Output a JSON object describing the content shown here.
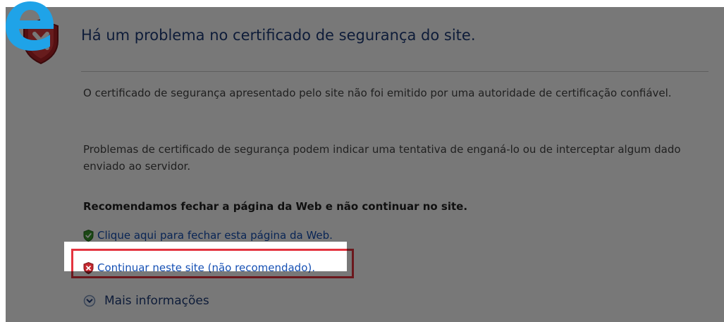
{
  "page": {
    "title": "Há um problema no certificado de segurança do site.",
    "paragraph1": "O certificado de segurança apresentado pelo site não foi emitido por uma autoridade de certificação confiável.",
    "paragraph2": "Problemas de certificado de segurança podem indicar uma tentativa de enganá-lo ou de interceptar algum dado enviado ao servidor.",
    "recommendation": "Recomendamos fechar a página da Web e não continuar no site.",
    "close_link": "Clique aqui para fechar esta página da Web.",
    "continue_link": "Continuar neste site (não recomendado).",
    "more_info": "Mais informações"
  },
  "icons": {
    "logo": "browser-e-logo-icon",
    "main_shield": "red-x-shield-icon",
    "close_shield": "green-check-shield-icon",
    "continue_shield": "red-x-shield-icon",
    "more_info": "chevron-down-circle-icon"
  },
  "colors": {
    "logo_blue": "#1fa3e8",
    "title": "#1f3d7a",
    "link": "#1550b4",
    "highlight": "#e4343f",
    "ok_green": "#3a9a2e",
    "error_red": "#c4282f"
  }
}
